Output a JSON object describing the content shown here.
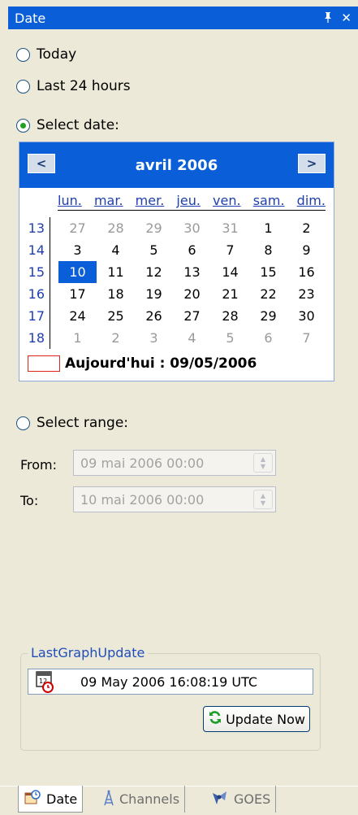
{
  "panel": {
    "title": "Date",
    "pin_glyph": "⎓",
    "close_glyph": "✕"
  },
  "options": {
    "today": "Today",
    "last24": "Last 24 hours",
    "select_date": "Select date:",
    "select_range": "Select range:",
    "selected": "select_date"
  },
  "calendar": {
    "month_label": "avril 2006",
    "prev_glyph": "<",
    "next_glyph": ">",
    "weekdays": [
      "lun.",
      "mar.",
      "mer.",
      "jeu.",
      "ven.",
      "sam.",
      "dim."
    ],
    "week_numbers": [
      "13",
      "14",
      "15",
      "16",
      "17",
      "18"
    ],
    "rows": [
      [
        "27",
        "28",
        "29",
        "30",
        "31",
        "1",
        "2"
      ],
      [
        "3",
        "4",
        "5",
        "6",
        "7",
        "8",
        "9"
      ],
      [
        "10",
        "11",
        "12",
        "13",
        "14",
        "15",
        "16"
      ],
      [
        "17",
        "18",
        "19",
        "20",
        "21",
        "22",
        "23"
      ],
      [
        "24",
        "25",
        "26",
        "27",
        "28",
        "29",
        "30"
      ],
      [
        "1",
        "2",
        "3",
        "4",
        "5",
        "6",
        "7"
      ]
    ],
    "today_label": "Aujourd'hui : 09/05/2006"
  },
  "range": {
    "from_label": "From:",
    "to_label": "To:",
    "from_value": "09  mai  2006  00:00",
    "to_value": "10  mai  2006  00:00"
  },
  "last_update": {
    "legend": "LastGraphUpdate",
    "value": "09 May 2006 16:08:19 UTC",
    "button_label": "Update Now"
  },
  "tabs": [
    {
      "label": "Date"
    },
    {
      "label": "Channels"
    },
    {
      "label": "GOES"
    }
  ],
  "colors": {
    "accent_blue": "#0A5FD8",
    "panel_bg": "#ECE9D8",
    "today_marker": "#E0241C"
  }
}
